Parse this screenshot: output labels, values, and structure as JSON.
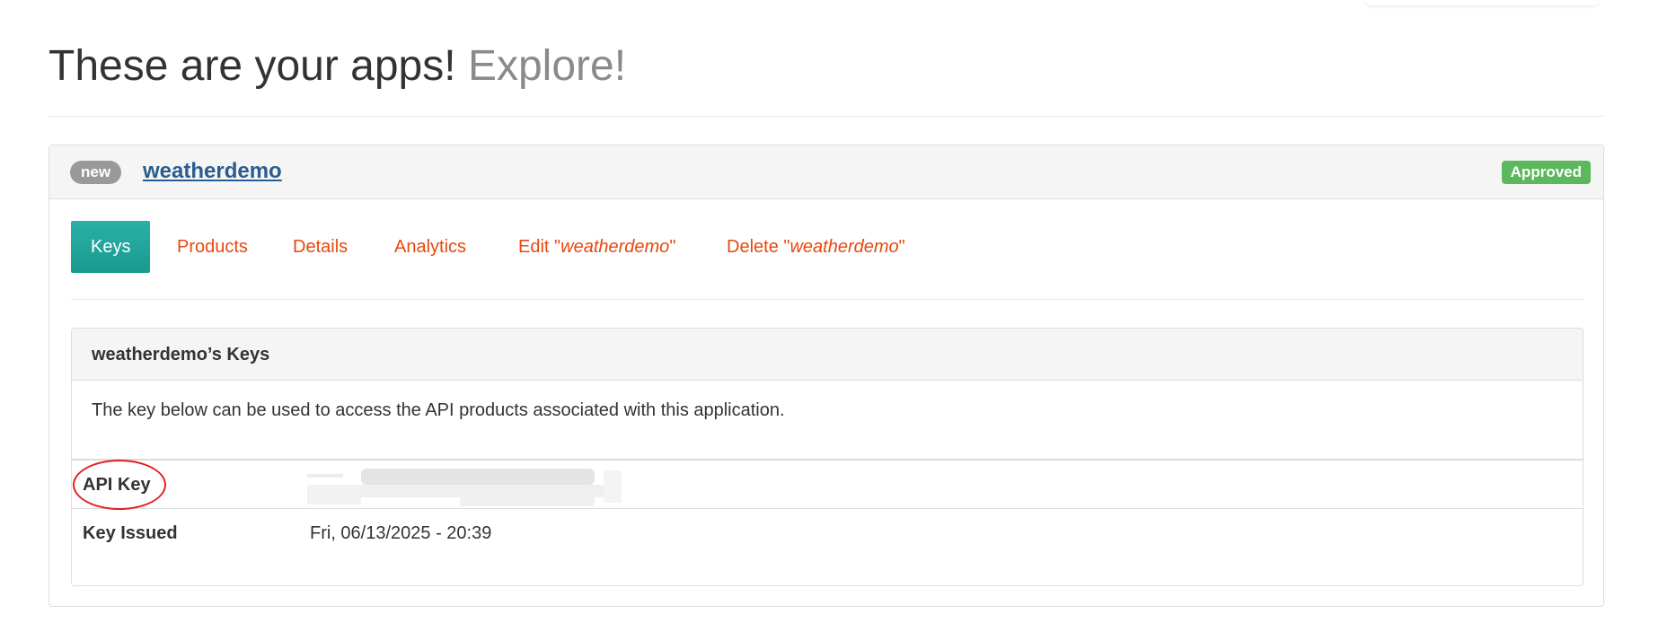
{
  "header": {
    "title": "These are your apps!",
    "subtitle": "Explore!"
  },
  "app": {
    "badge": "new",
    "name": "weatherdemo",
    "status": "Approved",
    "tabs": [
      {
        "label": "Keys",
        "active": true
      },
      {
        "label": "Products"
      },
      {
        "label": "Details"
      },
      {
        "label": "Analytics"
      },
      {
        "prefix": "Edit \"",
        "emph": "weatherdemo",
        "suffix": "\""
      },
      {
        "prefix": "Delete \"",
        "emph": "weatherdemo",
        "suffix": "\""
      }
    ],
    "keys": {
      "heading": "weatherdemo’s Keys",
      "description": "The key below can be used to access the API products associated with this application.",
      "rows": [
        {
          "label": "API Key",
          "value": ""
        },
        {
          "label": "Key Issued",
          "value": "Fri, 06/13/2025 - 20:39"
        }
      ]
    }
  },
  "colors": {
    "tab_link": "#e8480e",
    "tab_active": "#1fa398",
    "approved": "#5cb85c",
    "app_link": "#2a5d8f",
    "annotation_circle": "#e02020"
  }
}
